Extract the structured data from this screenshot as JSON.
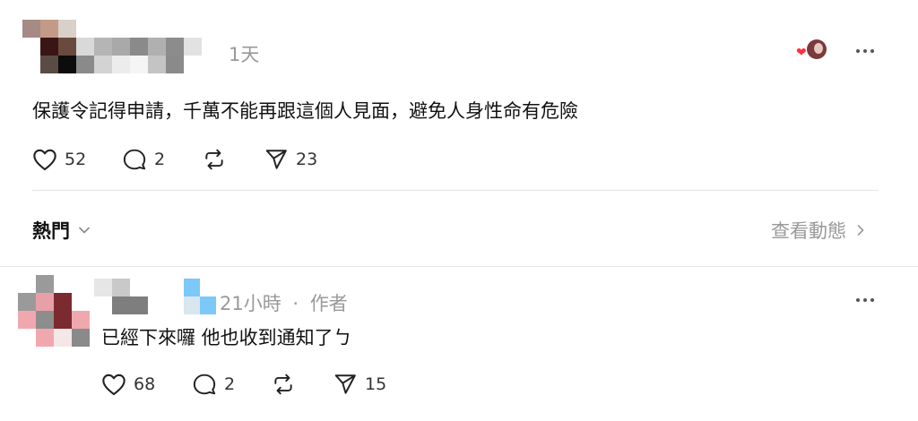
{
  "post": {
    "time": "1天",
    "text": "保護令記得申請，千萬不能再跟這個人見面，避免人身性命有危險",
    "likes": "52",
    "comments": "2",
    "shares": "23"
  },
  "replies_bar": {
    "sort_label": "熱門",
    "activity_link": "查看動態"
  },
  "reply": {
    "time": "21小時",
    "separator": "·",
    "author_tag": "作者",
    "text": "已經下來囉 他也收到通知了ㄅ",
    "likes": "68",
    "comments": "2",
    "shares": "15"
  },
  "colors": {
    "like_heart": "#ff3040",
    "divider": "#e5e5e5",
    "muted_text": "#999999"
  }
}
